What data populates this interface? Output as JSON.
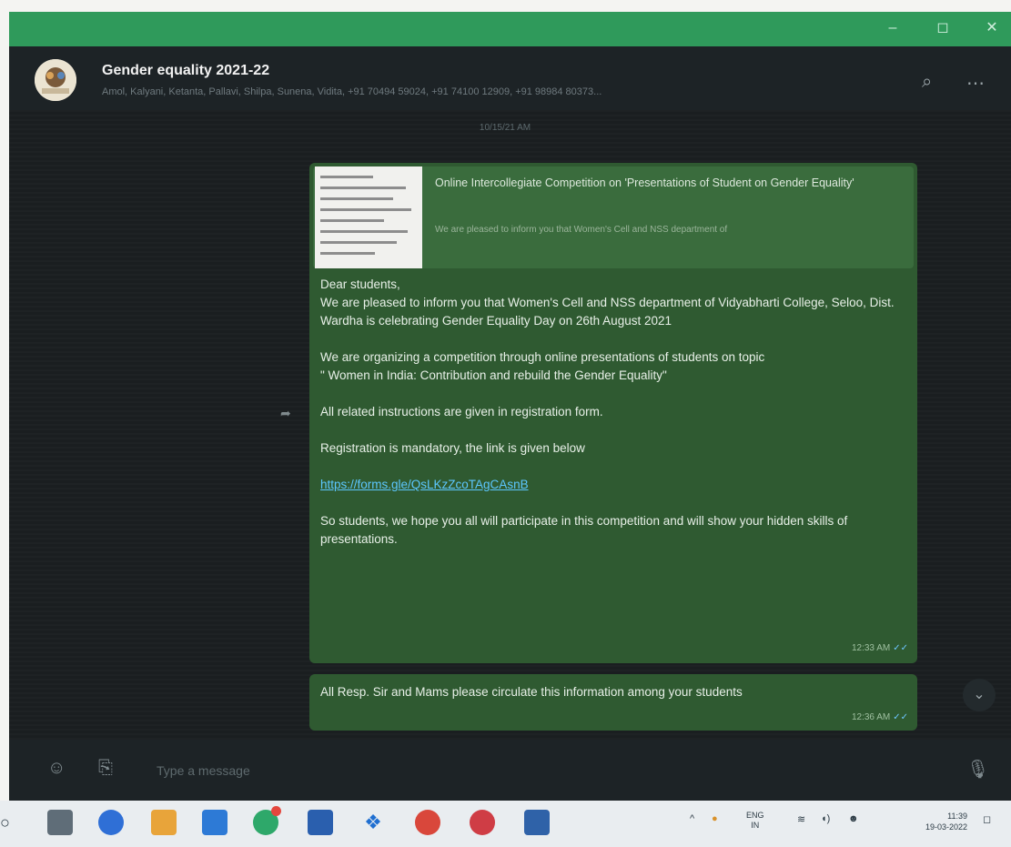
{
  "window": {
    "controls": {
      "minimize": "–",
      "maximize": "◻",
      "close": "✕"
    },
    "accent_color": "#2f9a5b"
  },
  "chat": {
    "title": "Gender equality 2021-22",
    "members_preview": "Amol, Kalyani, Ketanta, Pallavi, Shilpa, Sunena, Vidita, +91 70494 59024, +91 74100 12909, +91 98984 80373...",
    "date_label": "10/15/21 AM"
  },
  "messages": {
    "main": {
      "link_preview": {
        "title": "Online Intercollegiate Competition on 'Presentations of Student on Gender Equality'",
        "description": "We are pleased to inform you that Women's Cell and NSS department of"
      },
      "greeting": "Dear students,",
      "para1": "We are pleased to inform you that Women's Cell and NSS department of Vidyabharti College, Seloo, Dist. Wardha is celebrating Gender Equality Day on 26th August 2021",
      "para2": "We are organizing a competition through online presentations of students on topic",
      "para2_topic": "\" Women in India: Contribution and rebuild the Gender Equality\"",
      "para3": "All related instructions are given in registration form.",
      "para4": "Registration is mandatory, the link is given below",
      "link": "https://forms.gle/QsLKzZcoTAgCAsnB",
      "para5": "So students, we hope you all will participate in this competition and will show your hidden skills of presentations.",
      "time": "12:33 AM"
    },
    "second": {
      "text": "All Resp. Sir and Mams please circulate this information among your students",
      "time": "12:36 AM"
    }
  },
  "composer": {
    "placeholder": "Type a message"
  },
  "taskbar": {
    "lang_top": "ENG",
    "lang_bottom": "IN",
    "time": "11:39",
    "date": "19-03-2022"
  },
  "colors": {
    "bubble": "#2f5a31",
    "link": "#5cc7ff",
    "background": "#1a1e20"
  }
}
